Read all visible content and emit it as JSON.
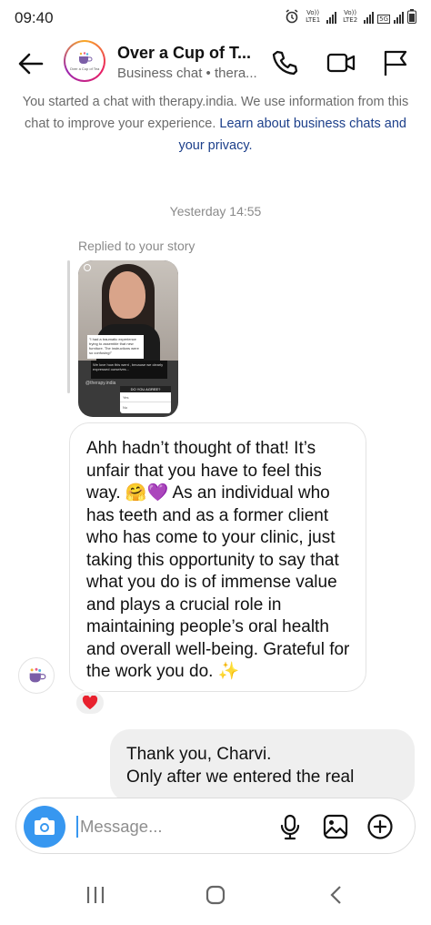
{
  "status_bar": {
    "time": "09:40",
    "sim1_label": "Vo)) LTE1",
    "sim2_label": "Vo)) LTE2",
    "network_badge": "5G"
  },
  "header": {
    "title": "Over a Cup of T...",
    "subtitle": "Business chat • thera...",
    "avatar_caption": "Over a Cup of Tea"
  },
  "intro": {
    "text": "You started a chat with therapy.india. We use information from this chat to improve your experience.",
    "link": "Learn about business chats and your privacy."
  },
  "thread": {
    "timestamp": "Yesterday 14:55",
    "replied_label": "Replied to your story",
    "story": {
      "caption_top": "\"I had a traumatic experience trying to assemble that new furniture. The instructions were so confusing!\"",
      "caption_bottom": "We love how this went , because we clearly expressed ourselves...",
      "handle": "@therapy.india",
      "poll_header": "DO YOU AGREE?",
      "poll_options": [
        "Yes",
        "No"
      ]
    },
    "incoming_message": "Ahh hadn’t thought of that! It’s unfair that you have to feel this way. 🤗💜 As an individual who has teeth and as a former client who has come to your clinic, just taking this opportunity to say that what you do is of immense value and plays a crucial role in maintaining people’s oral health and overall well-being. Grateful for the work you do. ✨",
    "reaction": "❤️",
    "outgoing_message": "Thank you, Charvi.\nOnly after we entered the real"
  },
  "composer": {
    "placeholder": "Message..."
  },
  "colors": {
    "accent": "#3797f0",
    "link": "#1c3f8a",
    "bubble_out": "#efefef"
  },
  "icons": [
    "back-arrow-icon",
    "phone-icon",
    "video-call-icon",
    "flag-icon",
    "camera-icon",
    "microphone-icon",
    "gallery-icon",
    "add-icon",
    "recent-apps-icon",
    "home-icon",
    "back-icon"
  ]
}
